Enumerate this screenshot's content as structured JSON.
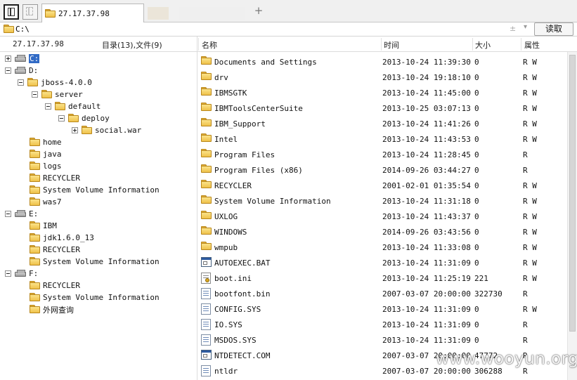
{
  "tabbar": {
    "active_tab_title": "27.17.37.98",
    "new_tab_label": "+"
  },
  "address": {
    "value": "C:\\",
    "dropdown_glyph": "±",
    "dropdown_arrow": "▾",
    "read_button": "读取"
  },
  "header": {
    "host": "27.17.37.98",
    "summary": "目录(13),文件(9)",
    "col_name": "名称",
    "col_time": "时间",
    "col_size": "大小",
    "col_attr": "属性"
  },
  "tree": [
    {
      "label": "C:",
      "icon": "drive-icon",
      "expander": "plus",
      "selected": true
    },
    {
      "label": "D:",
      "icon": "drive-icon",
      "expander": "minus"
    },
    {
      "label": "jboss-4.0.0",
      "icon": "folder-icon",
      "expander": "minus"
    },
    {
      "label": "server",
      "icon": "folder-icon",
      "expander": "minus"
    },
    {
      "label": "default",
      "icon": "folder-icon",
      "expander": "minus"
    },
    {
      "label": "deploy",
      "icon": "folder-icon",
      "expander": "minus"
    },
    {
      "label": "social.war",
      "icon": "folder-icon",
      "expander": "plus"
    },
    {
      "label": "home",
      "icon": "folder-icon"
    },
    {
      "label": "java",
      "icon": "folder-icon"
    },
    {
      "label": "logs",
      "icon": "folder-icon"
    },
    {
      "label": "RECYCLER",
      "icon": "folder-icon"
    },
    {
      "label": "System Volume Information",
      "icon": "folder-icon"
    },
    {
      "label": "was7",
      "icon": "folder-icon"
    },
    {
      "label": "E:",
      "icon": "drive-icon",
      "expander": "minus"
    },
    {
      "label": "IBM",
      "icon": "folder-icon"
    },
    {
      "label": "jdk1.6.0_13",
      "icon": "folder-icon"
    },
    {
      "label": "RECYCLER",
      "icon": "folder-icon"
    },
    {
      "label": "System Volume Information",
      "icon": "folder-icon"
    },
    {
      "label": "F:",
      "icon": "drive-icon",
      "expander": "minus"
    },
    {
      "label": "RECYCLER",
      "icon": "folder-icon"
    },
    {
      "label": "System Volume Information",
      "icon": "folder-icon"
    },
    {
      "label": "外网查询",
      "icon": "folder-icon"
    }
  ],
  "files": [
    {
      "name": "Documents and Settings",
      "time": "2013-10-24 11:39:30",
      "size": "0",
      "attr": "R W",
      "icon": "folder-icon"
    },
    {
      "name": "drv",
      "time": "2013-10-24 19:18:10",
      "size": "0",
      "attr": "R W",
      "icon": "folder-icon"
    },
    {
      "name": "IBMSGTK",
      "time": "2013-10-24 11:45:00",
      "size": "0",
      "attr": "R W",
      "icon": "folder-icon"
    },
    {
      "name": "IBMToolsCenterSuite",
      "time": "2013-10-25 03:07:13",
      "size": "0",
      "attr": "R W",
      "icon": "folder-icon"
    },
    {
      "name": "IBM_Support",
      "time": "2013-10-24 11:41:26",
      "size": "0",
      "attr": "R W",
      "icon": "folder-icon"
    },
    {
      "name": "Intel",
      "time": "2013-10-24 11:43:53",
      "size": "0",
      "attr": "R W",
      "icon": "folder-icon"
    },
    {
      "name": "Program Files",
      "time": "2013-10-24 11:28:45",
      "size": "0",
      "attr": "R",
      "icon": "folder-icon"
    },
    {
      "name": "Program Files (x86)",
      "time": "2014-09-26 03:44:27",
      "size": "0",
      "attr": "R",
      "icon": "folder-icon"
    },
    {
      "name": "RECYCLER",
      "time": "2001-02-01 01:35:54",
      "size": "0",
      "attr": "R W",
      "icon": "folder-icon"
    },
    {
      "name": "System Volume Information",
      "time": "2013-10-24 11:31:18",
      "size": "0",
      "attr": "R W",
      "icon": "folder-icon"
    },
    {
      "name": "UXLOG",
      "time": "2013-10-24 11:43:37",
      "size": "0",
      "attr": "R W",
      "icon": "folder-icon"
    },
    {
      "name": "WINDOWS",
      "time": "2014-09-26 03:43:56",
      "size": "0",
      "attr": "R W",
      "icon": "folder-icon"
    },
    {
      "name": "wmpub",
      "time": "2013-10-24 11:33:08",
      "size": "0",
      "attr": "R W",
      "icon": "folder-icon"
    },
    {
      "name": "AUTOEXEC.BAT",
      "time": "2013-10-24 11:31:09",
      "size": "0",
      "attr": "R W",
      "icon": "window-file-icon"
    },
    {
      "name": "boot.ini",
      "time": "2013-10-24 11:25:19",
      "size": "221",
      "attr": "R W",
      "icon": "settings-file-icon"
    },
    {
      "name": "bootfont.bin",
      "time": "2007-03-07 20:00:00",
      "size": "322730",
      "attr": "R",
      "icon": "file-icon"
    },
    {
      "name": "CONFIG.SYS",
      "time": "2013-10-24 11:31:09",
      "size": "0",
      "attr": "R W",
      "icon": "file-icon"
    },
    {
      "name": "IO.SYS",
      "time": "2013-10-24 11:31:09",
      "size": "0",
      "attr": "R",
      "icon": "file-icon"
    },
    {
      "name": "MSDOS.SYS",
      "time": "2013-10-24 11:31:09",
      "size": "0",
      "attr": "R",
      "icon": "file-icon"
    },
    {
      "name": "NTDETECT.COM",
      "time": "2007-03-07 20:00:00",
      "size": "47772",
      "attr": "R",
      "icon": "window-file-icon"
    },
    {
      "name": "ntldr",
      "time": "2007-03-07 20:00:00",
      "size": "306288",
      "attr": "R",
      "icon": "file-icon"
    }
  ],
  "watermark": "www.wooyun.org",
  "colors": {
    "selection": "#316ac5",
    "folder": "#efc24a"
  }
}
